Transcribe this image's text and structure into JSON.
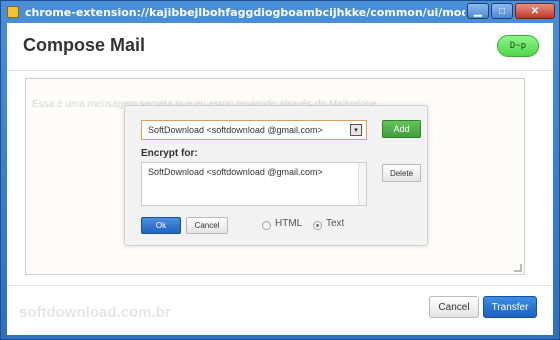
{
  "window": {
    "title": "chrome-extension://kajibbejlbohfaggdiogboambcijhkke/common/ui/modal/editor.html?parent=re0hdvfr&editor...",
    "controls": {
      "minimize": "▁",
      "maximize": "□",
      "close": "✕"
    }
  },
  "header": {
    "title": "Compose Mail",
    "badge": "D~p"
  },
  "editor": {
    "text": "Essa é uma mensagem secreta que eu estou enviando através do Mailvelope"
  },
  "dialog": {
    "recipient_select_value": "SoftDownload <softdownload   @gmail.com>",
    "select_arrow": "▾",
    "add_label": "Add",
    "encrypt_for_label": "Encrypt for:",
    "recipients": [
      "SoftDownload <softdownload   @gmail.com>"
    ],
    "delete_label": "Delete",
    "ok_label": "Ok",
    "cancel_label": "Cancel",
    "format_options": [
      {
        "label": "HTML",
        "selected": false
      },
      {
        "label": "Text",
        "selected": true
      }
    ]
  },
  "footer": {
    "watermark": "softdownload.com.br",
    "cancel_label": "Cancel",
    "transfer_label": "Transfer"
  },
  "colors": {
    "titlebar": "#2f6fbf",
    "badge": "#4ed64a",
    "add_button": "#3f9e39",
    "primary_button": "#1f63c2"
  }
}
